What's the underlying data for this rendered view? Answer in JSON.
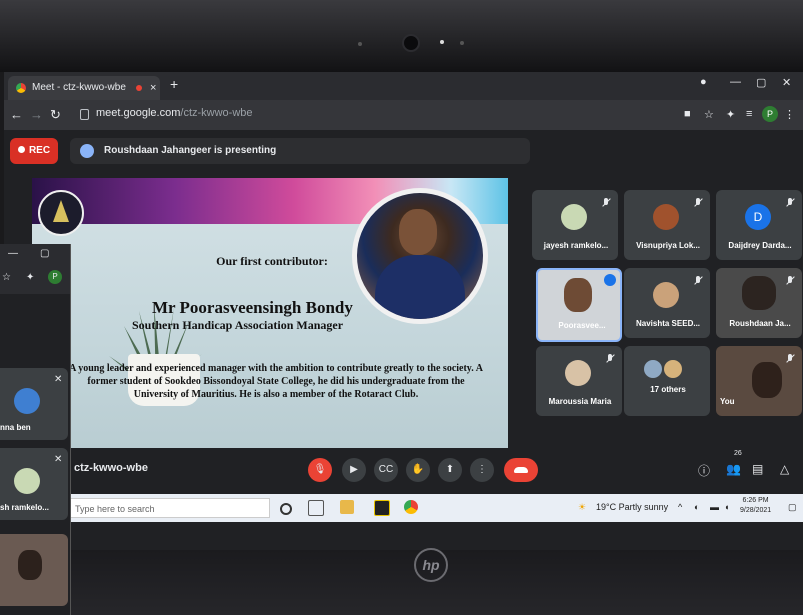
{
  "browser": {
    "tab_title": "Meet - ctz-kwwo-wbe",
    "tab_close": "×",
    "new_tab": "+",
    "url_host": "meet.google.com",
    "url_path": "/ctz-kwwo-wbe",
    "profile_initial": "P",
    "window_controls": [
      "—",
      "▢",
      "✕"
    ]
  },
  "meet": {
    "rec_label": "REC",
    "presenting_text": "Roushdaan Jahangeer is presenting",
    "meeting_code": "ctz-kwwo-wbe",
    "people_count": "26"
  },
  "slide": {
    "subtitle": "Our first contributor:",
    "name": "Mr Poorasveensingh Bondy",
    "role": "Southern Handicap Association Manager",
    "body": "A young leader and experienced manager with the ambition to contribute greatly to the society. A former student of Sookdeo Bissondoyal State College, he did his undergraduate from the University of Mauritius. He is also a member of the Rotaract Club."
  },
  "participants": [
    {
      "name": "jayesh ramkelo...",
      "avatar": ""
    },
    {
      "name": "Visnupriya Lok...",
      "avatar": ""
    },
    {
      "name": "Daijdrey Darda...",
      "avatar": "D"
    },
    {
      "name": "Poorasvee...",
      "avatar": ""
    },
    {
      "name": "Navishta SEED...",
      "avatar": ""
    },
    {
      "name": "Roushdaan Ja...",
      "avatar": ""
    },
    {
      "name": "Maroussia Maria",
      "avatar": ""
    },
    {
      "name": "17 others",
      "avatar": ""
    },
    {
      "name": "You",
      "avatar": ""
    }
  ],
  "taskbar": {
    "search_placeholder": "Type here to search",
    "weather": "19°C  Partly sunny",
    "time": "6:26 PM",
    "date": "9/28/2021"
  },
  "overlay": {
    "participants": [
      "nna ben",
      "sh ramkelo..."
    ],
    "profile_initial": "P"
  },
  "brand": "hp"
}
